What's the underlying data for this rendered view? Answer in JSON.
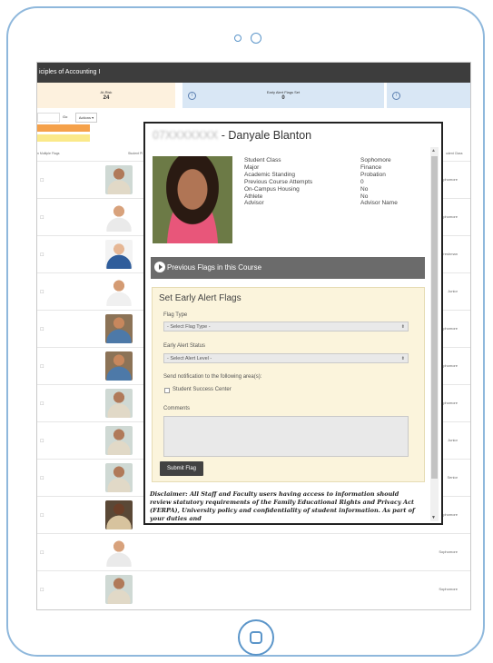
{
  "app": {
    "course_title": "iciples of Accounting I"
  },
  "stats": {
    "at_risk_label": "At-Risk",
    "at_risk_value": "24",
    "flags_set_label": "Early Alert Flags Set",
    "flags_set_value": "0"
  },
  "filters": {
    "go_label": "Go",
    "actions_label": "Actions ▾"
  },
  "table": {
    "col_multiple_flags": "n Multiple Flags",
    "col_student_photo": "Student Pl",
    "col_student_class": "udent Class",
    "row_classes": [
      "Sophomore",
      "",
      "Sophomore",
      "Freshman",
      "Junior",
      "Sophomore",
      "Sophomore",
      "Sophomore",
      "Junior",
      "Senior",
      "Sophomore",
      "Sophomore",
      "Sophomore"
    ]
  },
  "student": {
    "id_masked": "07XXXXXXX",
    "separator": "-",
    "name": "Danyale Blanton",
    "fields": [
      {
        "label": "Student Class",
        "value": "Sophomore"
      },
      {
        "label": "Major",
        "value": "Finance"
      },
      {
        "label": "Academic Standing",
        "value": "Probation"
      },
      {
        "label": "Previous Course Attempts",
        "value": "0"
      },
      {
        "label": "On-Campus Housing",
        "value": "No"
      },
      {
        "label": "Athlete",
        "value": "No"
      },
      {
        "label": "Advisor",
        "value": "Advisor Name"
      }
    ]
  },
  "previous_flags": {
    "label": "Previous Flags in this Course"
  },
  "flag_form": {
    "title": "Set Early Alert Flags",
    "flag_type_label": "Flag Type",
    "flag_type_placeholder": "- Select Flag Type -",
    "alert_status_label": "Early Alert Status",
    "alert_status_placeholder": "- Select Alert Level -",
    "notify_label": "Send notification to the following area(s):",
    "notify_option": "Student Success Center",
    "comments_label": "Comments",
    "submit_label": "Submit Flag"
  },
  "disclaimer": {
    "text": "Disclaimer: All Staff and Faculty users having access to information should review statutory requirements of the Family Educational Rights and Privacy Act (FERPA), University policy and confidentiality of student information. As part of your duties and"
  },
  "colors": {
    "accent_orange": "#f5a14a",
    "accent_yellow": "#fbe98a",
    "stat_blue": "#d9e7f5",
    "form_bg": "#fbf4dc",
    "frame_blue": "#5b95c9"
  }
}
